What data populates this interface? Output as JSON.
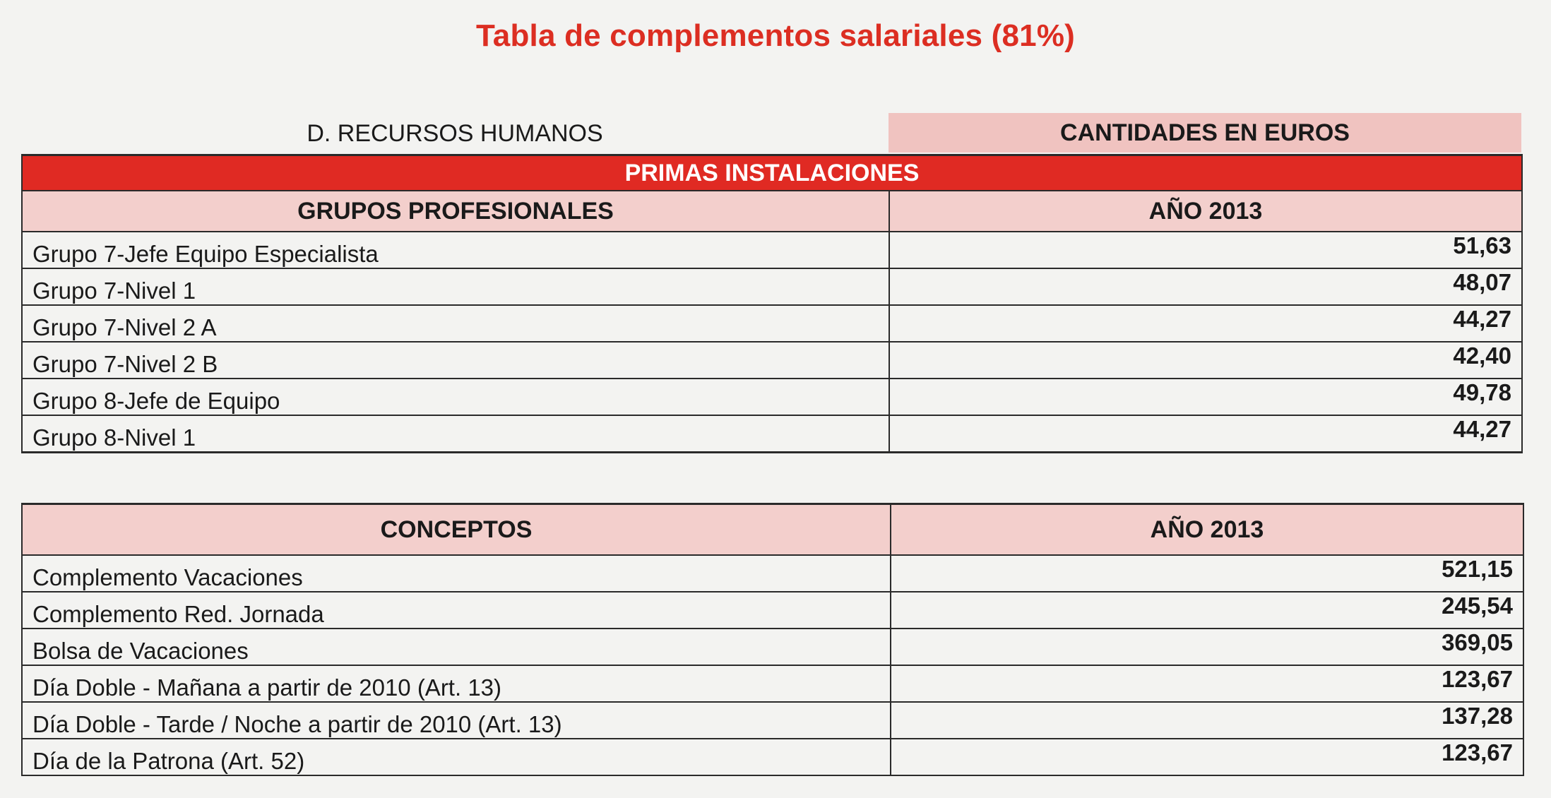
{
  "title": "Tabla de complementos salariales (81%)",
  "department": "D. RECURSOS HUMANOS",
  "units": "CANTIDADES EN EUROS",
  "primas": {
    "banner": "PRIMAS INSTALACIONES",
    "col_group": "GRUPOS PROFESIONALES",
    "col_year": "AÑO 2013",
    "rows": [
      {
        "label": "Grupo 7-Jefe Equipo Especialista",
        "value": "51,63"
      },
      {
        "label": "Grupo 7-Nivel 1",
        "value": "48,07"
      },
      {
        "label": "Grupo 7-Nivel 2 A",
        "value": "44,27"
      },
      {
        "label": "Grupo 7-Nivel 2 B",
        "value": "42,40"
      },
      {
        "label": "Grupo 8-Jefe de Equipo",
        "value": "49,78"
      },
      {
        "label": "Grupo 8-Nivel 1",
        "value": "44,27"
      }
    ]
  },
  "conceptos": {
    "col_concept": "CONCEPTOS",
    "col_year": "AÑO 2013",
    "rows": [
      {
        "label": "Complemento Vacaciones",
        "value": "521,15"
      },
      {
        "label": "Complemento Red. Jornada",
        "value": "245,54"
      },
      {
        "label": "Bolsa de Vacaciones",
        "value": "369,05"
      },
      {
        "label": "Día Doble - Mañana a partir de 2010 (Art. 13)",
        "value": "123,67"
      },
      {
        "label": "Día Doble - Tarde / Noche a partir de 2010 (Art. 13)",
        "value": "137,28"
      },
      {
        "label": "Día de la Patrona (Art. 52)",
        "value": "123,67"
      }
    ]
  },
  "colors": {
    "title": "#dc2e22",
    "banner": "#e02a23",
    "header_fill": "#f3cfcc"
  }
}
